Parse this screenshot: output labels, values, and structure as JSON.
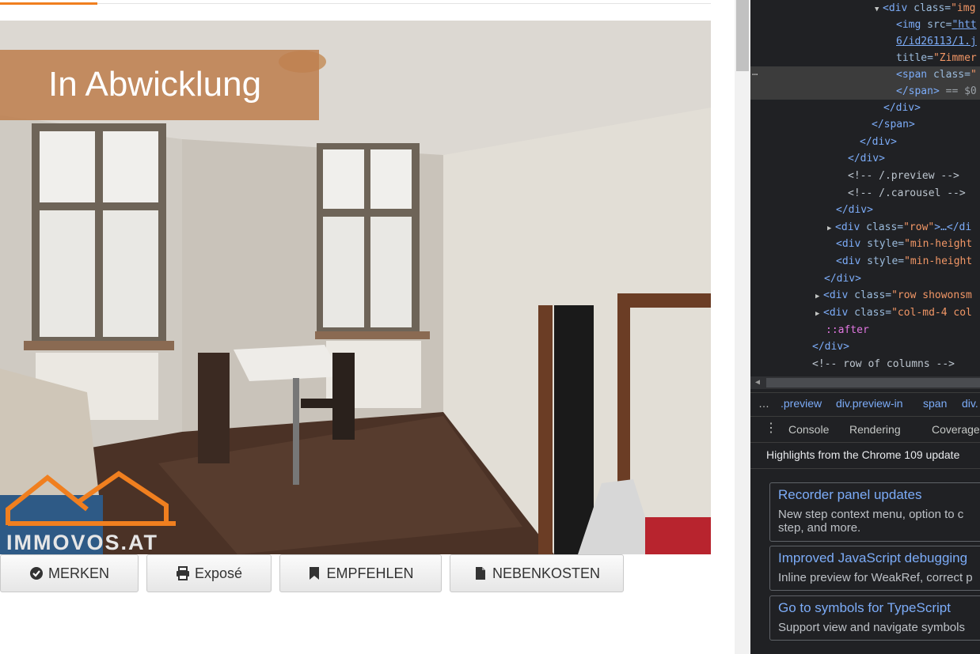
{
  "listing": {
    "status_banner": "In Abwicklung",
    "logo_text": "IMMOVOS.AT",
    "buttons": {
      "merken": "MERKEN",
      "expose": "Exposé",
      "empfehlen": "EMPFEHLEN",
      "nebenkosten": "NEBENKOSTEN"
    },
    "accent_color": "#f07f1f"
  },
  "devtools": {
    "dom_lines": [
      {
        "open": "▼",
        "tag": "<div",
        "attr": " class=",
        "val": "\"img"
      },
      {
        "tag": "<img",
        "attr": " src=",
        "val": "\"htt"
      },
      {
        "link": "6/id26113/1.j"
      },
      {
        "attr": "title=",
        "val": "\"Zimmer"
      },
      {
        "tag": "<span",
        "attr": " class=",
        "val": "\""
      },
      {
        "tag": "</span>",
        "text": " == $0"
      },
      {
        "tag": "</div>"
      },
      {
        "tag": "</span>"
      },
      {
        "tag": "</div>"
      },
      {
        "tag": "</div>"
      },
      {
        "comment": "<!-- /.preview -->"
      },
      {
        "comment": "<!-- /.carousel -->"
      },
      {
        "tag": "</div>"
      },
      {
        "open": "▶",
        "tag": "<div",
        "attr": " class=",
        "val": "\"row\"",
        "tag2": ">…</di"
      },
      {
        "tag": "<div",
        "attr": " style=",
        "val": "\"min-height"
      },
      {
        "tag": "<div",
        "attr": " style=",
        "val": "\"min-height"
      },
      {
        "tag": "</div>"
      },
      {
        "open": "▶",
        "tag": "<div",
        "attr": " class=",
        "val": "\"row showonsm"
      },
      {
        "open": "▶",
        "tag": "<div",
        "attr": " class=",
        "val": "\"col-md-4 col"
      },
      {
        "pseudo": "::after"
      },
      {
        "tag": "</div>"
      },
      {
        "comment": "<!--  row of columns -->"
      }
    ],
    "breadcrumbs": [
      "…",
      ".preview",
      "div.preview-in",
      "span",
      "div."
    ],
    "drawer_tabs": [
      "Console",
      "Rendering",
      "Coverage"
    ],
    "whats_new_title": "Highlights from the Chrome 109 update",
    "cards": [
      {
        "title": "Recorder panel updates",
        "desc1": "New step context menu, option to c",
        "desc2": "step, and more."
      },
      {
        "title": "Improved JavaScript debugging",
        "desc1": "Inline preview for WeakRef, correct p",
        "desc2": ""
      },
      {
        "title": "Go to symbols for TypeScript",
        "desc1": "Support view and navigate symbols",
        "desc2": ""
      }
    ]
  }
}
